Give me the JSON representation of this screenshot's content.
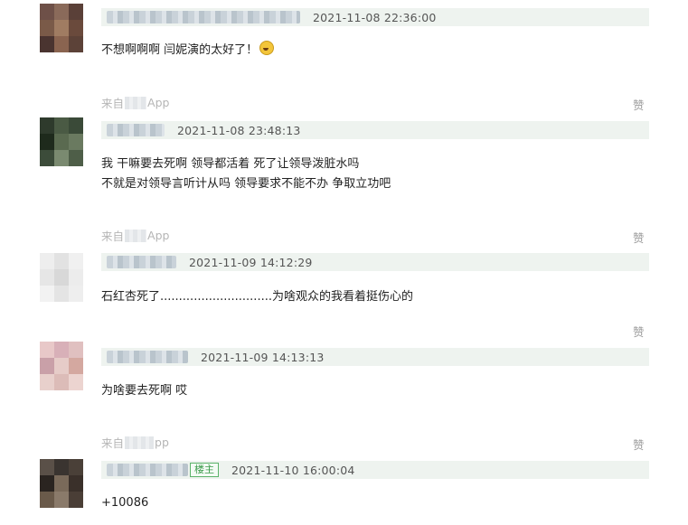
{
  "comments": [
    {
      "date": "2021-11-08 22:36:00",
      "lines": [
        "不想啊啊啊 闫妮演的太好了！"
      ],
      "has_emoji": true,
      "emoji_icon": "crying-face-icon",
      "source_prefix": "来自",
      "source_suffix": "App",
      "like_label": "赞"
    },
    {
      "date": "2021-11-08 23:48:13",
      "lines": [
        "我 干嘛要去死啊 领导都活着 死了让领导泼脏水吗",
        "不就是对领导言听计从吗 领导要求不能不办 争取立功吧"
      ],
      "source_prefix": "来自",
      "source_suffix": "App",
      "like_label": "赞"
    },
    {
      "date": "2021-11-09 14:12:29",
      "lines": [
        "石红杏死了..............................为啥观众的我看着挺伤心的"
      ],
      "like_label": "赞"
    },
    {
      "date": "2021-11-09 14:13:13",
      "lines": [
        "为啥要去死啊 哎"
      ],
      "source_prefix": "来自",
      "source_suffix": "pp",
      "like_label": "赞"
    },
    {
      "date": "2021-11-10 16:00:04",
      "badge": "楼主",
      "lines": [
        "+10086"
      ]
    }
  ]
}
